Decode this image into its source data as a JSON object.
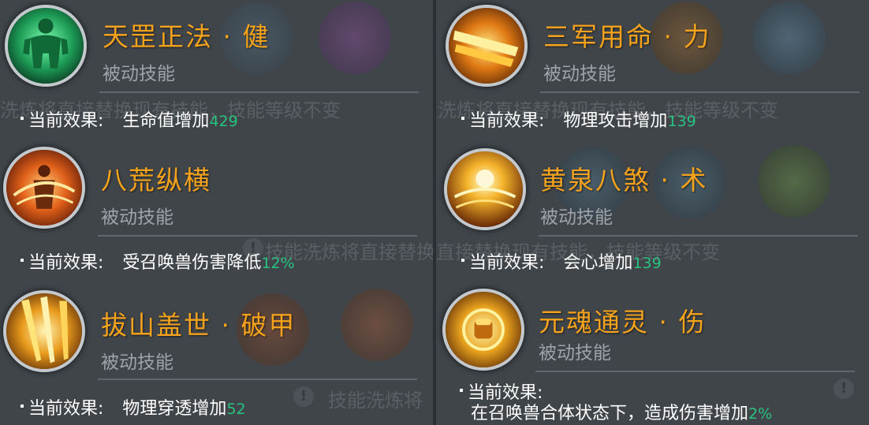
{
  "background_text": {
    "line1": "洗炼将直接替换现有技能，技能等级不变",
    "line2": "技能洗炼将直接替换现有技能，技能等级不变",
    "line3": "技能洗炼将"
  },
  "left_skills": [
    {
      "name": "天罡正法 · 健",
      "type": "被动技能",
      "label": "当前效果:",
      "desc": "生命值增加",
      "value": "429"
    },
    {
      "name": "八荒纵横",
      "type": "被动技能",
      "label": "当前效果:",
      "desc": "受召唤兽伤害降低",
      "value": "12%"
    },
    {
      "name": "拔山盖世 · 破甲",
      "type": "被动技能",
      "label": "当前效果:",
      "desc": "物理穿透增加",
      "value": "52"
    }
  ],
  "right_skills": [
    {
      "name": "三军用命 · 力",
      "type": "被动技能",
      "label": "当前效果:",
      "desc": "物理攻击增加",
      "value": "139"
    },
    {
      "name": "黄泉八煞 · 术",
      "type": "被动技能",
      "label": "当前效果:",
      "desc": "会心增加",
      "value": "139"
    },
    {
      "name": "元魂通灵 · 伤",
      "type": "被动技能",
      "label": "当前效果:",
      "desc": "在召唤兽合体状态下，造成伤害增加",
      "value": "2%"
    }
  ],
  "icons": {
    "left": [
      "green-muscle-body-icon",
      "fire-warrior-icon",
      "golden-blades-icon"
    ],
    "right": [
      "golden-sword-icon",
      "golden-sunburst-icon",
      "golden-fist-icon"
    ]
  },
  "colors": {
    "skill_name": "#f5a31c",
    "value_green": "#27c37f",
    "subtitle_gray": "#9da3a9",
    "panel_bg": "#40454a"
  }
}
